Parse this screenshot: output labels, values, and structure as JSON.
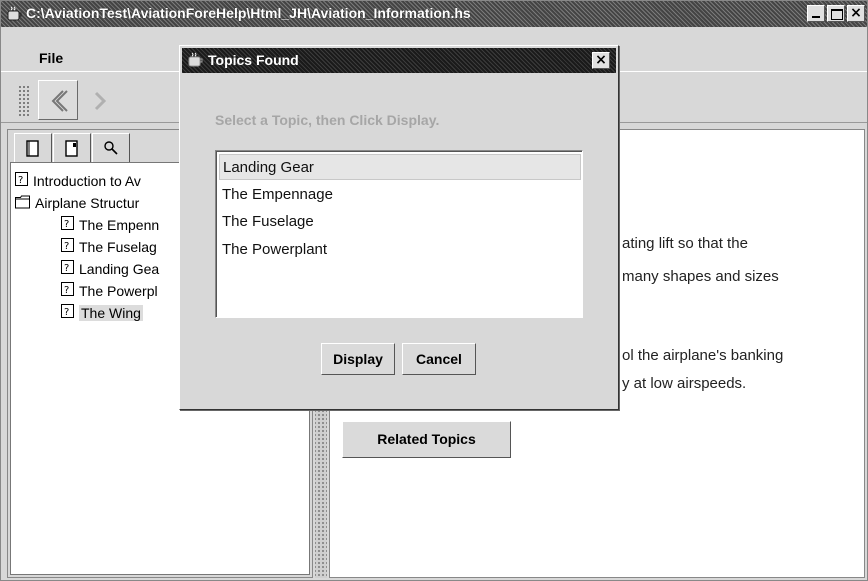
{
  "window": {
    "title": "C:\\AviationTest\\AviationForeHelp\\Html_JH\\Aviation_Information.hs",
    "close_glyph": "×"
  },
  "menu": {
    "file_label": "File"
  },
  "toolbar": {
    "back_icon": "back-arrow-icon",
    "forward_icon": "forward-arrow-icon"
  },
  "tabs": [
    {
      "icon": "book-icon"
    },
    {
      "icon": "index-icon"
    },
    {
      "icon": "search-icon"
    }
  ],
  "tree": {
    "items": [
      {
        "label": "Introduction to Av",
        "icon": "help-page-icon"
      },
      {
        "label": "Airplane Structur",
        "icon": "folder-icon"
      },
      {
        "label": "The Empenn",
        "icon": "help-page-icon"
      },
      {
        "label": "The Fuselag",
        "icon": "help-page-icon"
      },
      {
        "label": "Landing Gea",
        "icon": "help-page-icon"
      },
      {
        "label": "The Powerpl",
        "icon": "help-page-icon"
      },
      {
        "label": "The Wing",
        "icon": "help-page-icon"
      }
    ]
  },
  "content": {
    "line1": "ating lift so that the",
    "line2": "many shapes and sizes",
    "line3": "ol the airplane's banking",
    "line4": "y at low airspeeds.",
    "related_button": "Related Topics"
  },
  "dialog": {
    "title": "Topics Found",
    "close_glyph": "×",
    "prompt": "Select a Topic, then Click Display.",
    "topics": [
      "Landing Gear",
      "The Empennage",
      "The Fuselage",
      "The Powerplant"
    ],
    "display_button": "Display",
    "cancel_button": "Cancel"
  }
}
